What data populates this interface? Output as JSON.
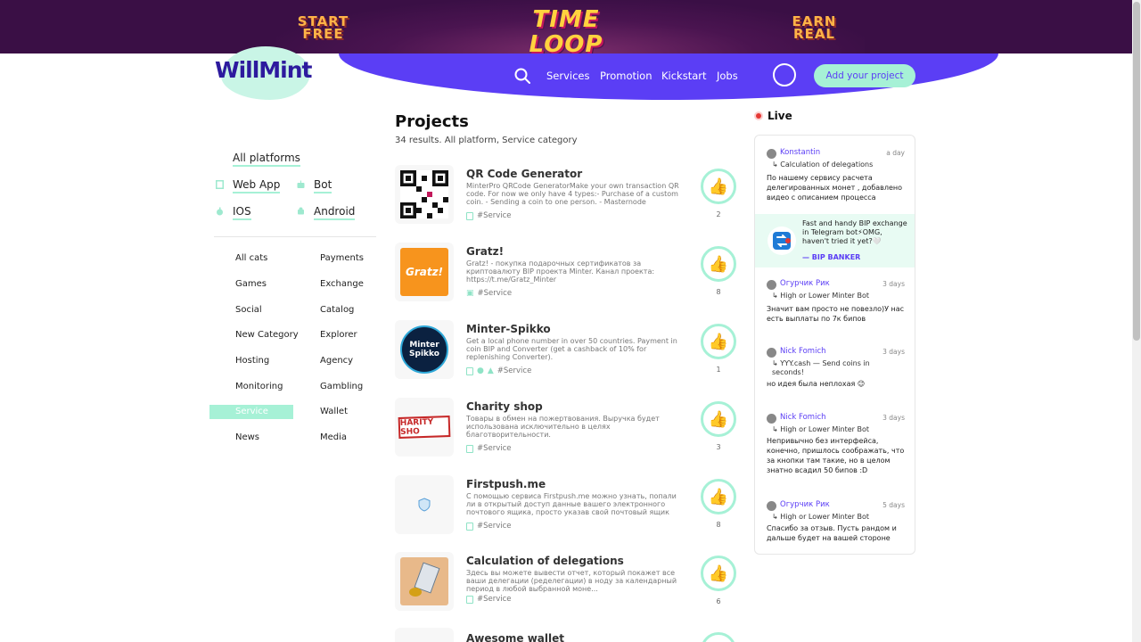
{
  "banner": {
    "left_text": "START FREE",
    "title": "TIME LOOP",
    "right_text": "EARN REAL"
  },
  "header": {
    "logo": "WillMint",
    "nav": [
      "Services",
      "Promotion",
      "Kickstart",
      "Jobs"
    ],
    "add_project": "Add your project"
  },
  "sidebar": {
    "platforms": {
      "all": "All platforms",
      "web_app": "Web App",
      "bot": "Bot",
      "ios": "IOS",
      "android": "Android"
    },
    "categories_left": [
      "All cats",
      "Games",
      "Social",
      "New Category",
      "Hosting",
      "Monitoring",
      "Service",
      "News"
    ],
    "categories_right": [
      "Payments",
      "Exchange",
      "Catalog",
      "Explorer",
      "Agency",
      "Gambling",
      "Wallet",
      "Media"
    ],
    "active_category": "Service"
  },
  "projects": {
    "title": "Projects",
    "subtitle": "34 results. All platform, Service category",
    "items": [
      {
        "title": "QR Code Generator",
        "desc": "MinterPro QRCode GeneratorMake your own transaction QR code. For now we only have 4 types:- Purchase of a custom coin. - Sending a coin to one person. - Masternode delegatio...",
        "tag": "#Service",
        "likes": "2"
      },
      {
        "title": "Gratz!",
        "desc": "Gratz! - покупка подарочных сертификатов за криптовалюту BIP проекта Minter. Канал проекта: https://t.me/Gratz_Minter",
        "tag": "#Service",
        "likes": "8"
      },
      {
        "title": "Minter-Spikko",
        "desc": "Get a local phone number in over 50 countries. Payment in coin BIP and Converter (get a cashback of 10% for replenishing Converter).",
        "tag": "#Service",
        "likes": "1"
      },
      {
        "title": "Charity shop",
        "desc": "Товары в обмен на пожертвования. Выручка будет использована исключительно в целях благотворительности.",
        "tag": "#Service",
        "likes": "3"
      },
      {
        "title": "Firstpush.me",
        "desc": "С помощью сервиса Firstpush.me можно узнать, попали ли в открытый доступ данные вашего электронного почтового ящика, просто указав свой почтовый ящик и...",
        "tag": "#Service",
        "likes": "8"
      },
      {
        "title": "Calculation of delegations",
        "desc": "Здесь вы можете вывести отчет, который покажет все ваши делегации (ределегации) в ноду за календарный период в любой выбранной моне...",
        "tag": "#Service",
        "likes": "6"
      },
      {
        "title": "Awesome wallet",
        "desc": "",
        "tag": "",
        "likes": ""
      }
    ]
  },
  "live": {
    "title": "Live",
    "comments": [
      {
        "user": "Konstantin",
        "time": "a day",
        "ref": "Calculation of delegations",
        "text": "По нашему сервису расчета делегированных монет , добавлено видео с описанием процесса"
      },
      {
        "user": "Огурчик Рик",
        "time": "3 days",
        "ref": "High or Lower Minter Bot",
        "text": "Значит вам просто не повезло)У нас есть выплаты по 7к бипов"
      },
      {
        "user": "Nick Fomich",
        "time": "3 days",
        "ref": "YYY.cash — Send coins in seconds!",
        "text": "но идея была неплохая 😉"
      },
      {
        "user": "Nick Fomich",
        "time": "3 days",
        "ref": "High or Lower Minter Bot",
        "text": "Непривычно без интерфейса, конечно, пришлось соображать, что за кнопки там такие, но в целом знатно всадил 50 бипов :D"
      },
      {
        "user": "Огурчик Рик",
        "time": "5 days",
        "ref": "High or Lower Minter Bot",
        "text": "Спасибо за отзыв. Пусть рандом и дальше будет на вашей стороне"
      }
    ],
    "ad": {
      "text": "Fast and handy BIP exchange in Telegram bot⚡OMG, haven't tried it yet?🤍",
      "sign": "— BIP BANKER"
    }
  },
  "colors": {
    "accent": "#5b3ef5",
    "mint": "#a6f1d6",
    "banner_bg": "#3a0f45"
  }
}
